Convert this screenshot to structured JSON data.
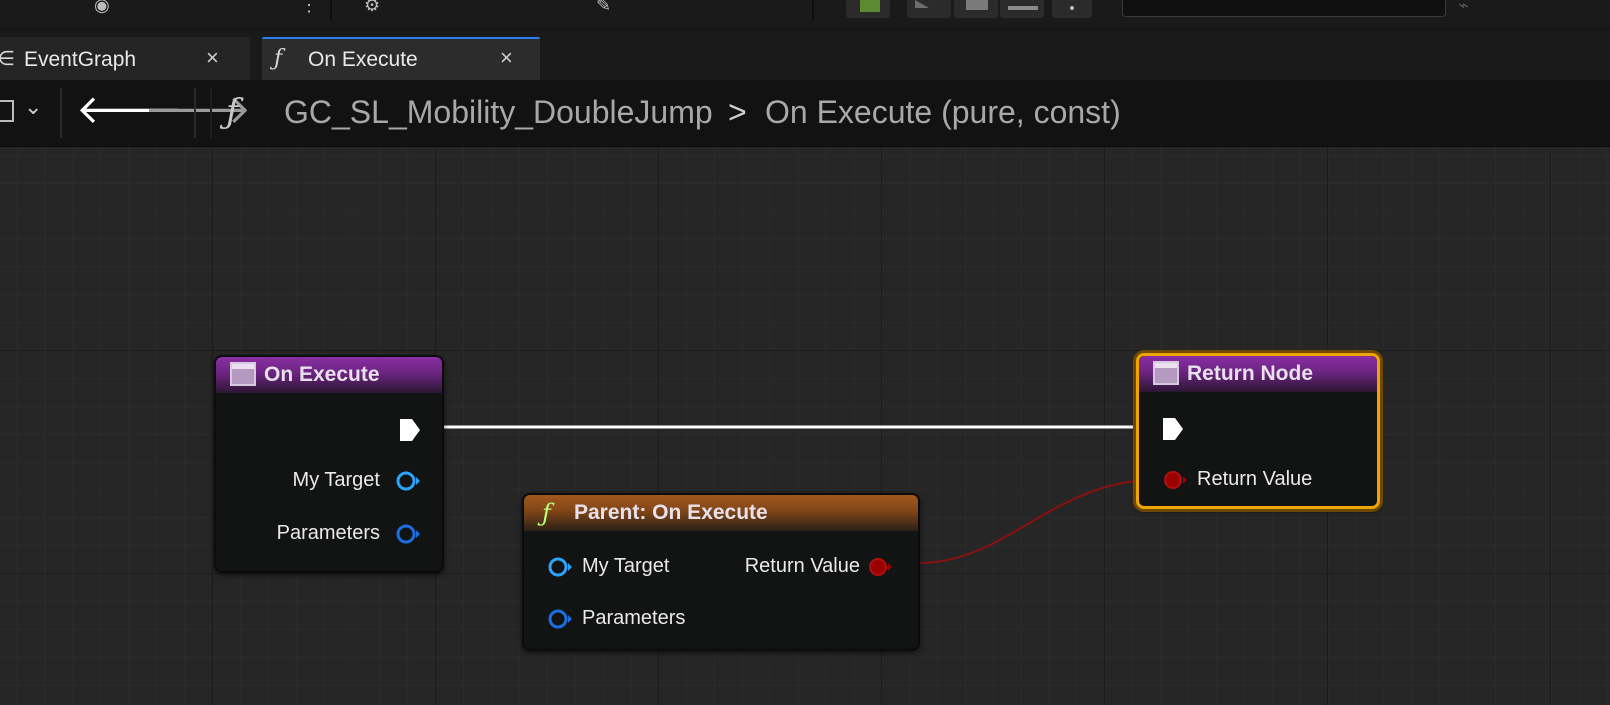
{
  "tabs": [
    {
      "label": "EventGraph",
      "icon": "graph-icon",
      "close": "×"
    },
    {
      "label": "On Execute",
      "icon": "function-icon",
      "close": "×",
      "active": true
    }
  ],
  "breadcrumb": {
    "function_glyph": "ƒ",
    "blueprint": "GC_SL_Mobility_DoubleJump",
    "separator": ">",
    "function": "On Execute (pure, const)"
  },
  "nodes": {
    "entry": {
      "title": "On Execute",
      "pins": [
        "My Target",
        "Parameters"
      ]
    },
    "parent_call": {
      "title": "Parent: On Execute",
      "function_glyph": "ƒ",
      "input_pins": [
        "My Target",
        "Parameters"
      ],
      "output_pin": "Return Value"
    },
    "return": {
      "title": "Return Node",
      "pins": [
        "Return Value"
      ]
    }
  },
  "colors": {
    "selection": "#f0a400",
    "exec_wire": "#ffffff",
    "bool_wire": "#8b1010",
    "object_pin": "#2aa4ff",
    "struct_pin": "#1a6fe0",
    "bool_pin": "#9a0000"
  }
}
